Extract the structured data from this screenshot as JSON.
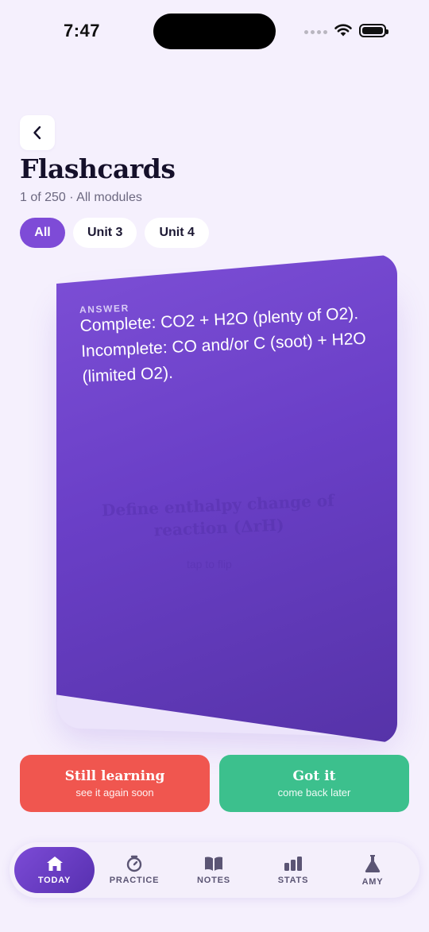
{
  "status_bar": {
    "time": "7:47"
  },
  "header": {
    "title": "Flashcards",
    "subtitle": "1 of 250 · All modules"
  },
  "filters": [
    {
      "label": "All",
      "active": true
    },
    {
      "label": "Unit 3",
      "active": false
    },
    {
      "label": "Unit 4",
      "active": false
    }
  ],
  "card": {
    "label": "ANSWER",
    "answer": "Complete: CO2 + H2O (plenty of O2). Incomplete: CO and/or C (soot) + H2O (limited O2).",
    "ghost_question": "Define enthalpy change of reaction (ΔrH)",
    "ghost_hint": "tap to flip"
  },
  "actions": {
    "still_learning": {
      "label": "Still learning",
      "sub": "see it again soon"
    },
    "got_it": {
      "label": "Got it",
      "sub": "come back later"
    }
  },
  "tabs": [
    {
      "label": "TODAY",
      "icon": "home-icon",
      "active": true
    },
    {
      "label": "PRACTICE",
      "icon": "timer-icon",
      "active": false
    },
    {
      "label": "NOTES",
      "icon": "book-icon",
      "active": false
    },
    {
      "label": "STATS",
      "icon": "bar-chart-icon",
      "active": false
    },
    {
      "label": "AMY",
      "icon": "flask-icon",
      "active": false
    }
  ],
  "colors": {
    "accent": "#7e4bd7",
    "still_learning": "#f0564f",
    "got_it": "#3cc08d",
    "background": "#f5f0fd"
  }
}
